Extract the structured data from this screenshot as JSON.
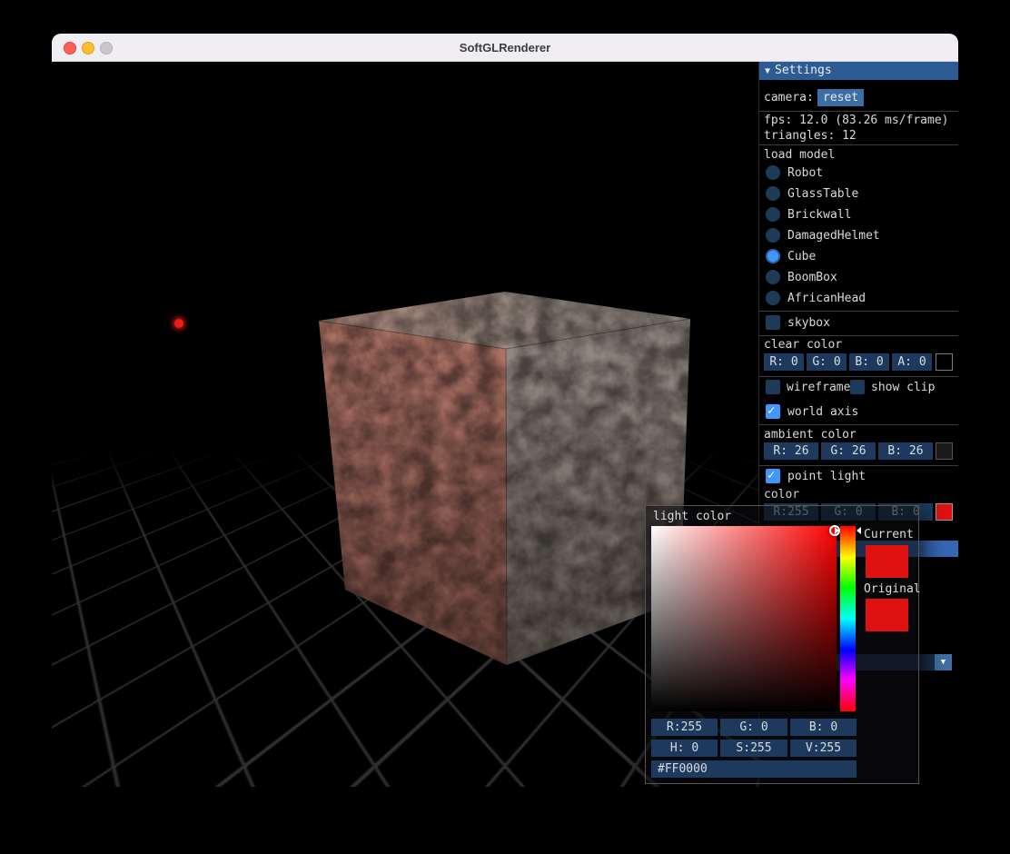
{
  "window": {
    "title": "SoftGLRenderer"
  },
  "settings": {
    "header_label": "Settings",
    "collapse_arrow": "▼",
    "camera_label": "camera:",
    "reset_button": "reset",
    "fps_text": "fps: 12.0 (83.26 ms/frame)",
    "triangles_text": "triangles: 12",
    "load_model_label": "load model",
    "models": [
      {
        "label": "Robot",
        "selected": false
      },
      {
        "label": "GlassTable",
        "selected": false
      },
      {
        "label": "Brickwall",
        "selected": false
      },
      {
        "label": "DamagedHelmet",
        "selected": false
      },
      {
        "label": "Cube",
        "selected": true
      },
      {
        "label": "BoomBox",
        "selected": false
      },
      {
        "label": "AfricanHead",
        "selected": false
      }
    ],
    "skybox": {
      "label": "skybox",
      "checked": false
    },
    "clear_color": {
      "label": "clear color",
      "r": "R: 0",
      "g": "G: 0",
      "b": "B: 0",
      "a": "A: 0",
      "swatch": "#000000"
    },
    "wireframe": {
      "label": "wireframe",
      "checked": false
    },
    "show_clip": {
      "label": "show clip",
      "checked": false
    },
    "world_axis": {
      "label": "world axis",
      "checked": true
    },
    "ambient_color": {
      "label": "ambient color",
      "r": "R: 26",
      "g": "G: 26",
      "b": "B: 26",
      "swatch": "#1a1a1a"
    },
    "point_light": {
      "label": "point light",
      "checked": true
    },
    "light_color": {
      "label": "color",
      "r": "R:255",
      "g": "G: 0",
      "b": "B: 0",
      "swatch": "#dd1111"
    },
    "combo_arrow": "▼"
  },
  "color_picker": {
    "title": "light color",
    "current_label": "Current",
    "original_label": "Original",
    "current_color": "#e01111",
    "original_color": "#e01111",
    "rgb": {
      "r": "R:255",
      "g": "G: 0",
      "b": "B: 0"
    },
    "hsv": {
      "h": "H: 0",
      "s": "S:255",
      "v": "V:255"
    },
    "hex": "#FF0000"
  }
}
